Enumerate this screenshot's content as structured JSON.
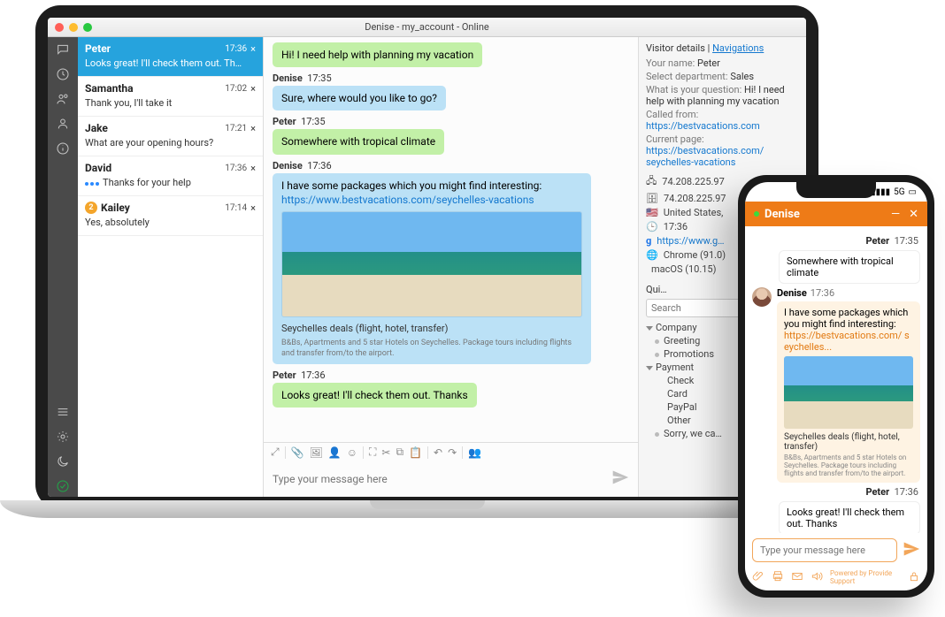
{
  "desktop": {
    "window_title": "Denise - my_account - Online",
    "conversations": [
      {
        "name": "Peter",
        "time": "17:36",
        "snippet": "Looks great! I'll check them out. Th…",
        "active": true,
        "close": "×"
      },
      {
        "name": "Samantha",
        "time": "17:02",
        "snippet": "Thank you, I'll take it",
        "close": "×"
      },
      {
        "name": "Jake",
        "time": "17:21",
        "snippet": "What are your opening hours?",
        "close": "×"
      },
      {
        "name": "David",
        "time": "17:36",
        "snippet": "Thanks for your help",
        "close": "×",
        "typing": true
      },
      {
        "name": "Kailey",
        "time": "17:14",
        "snippet": "Yes, absolutely",
        "close": "×",
        "badge": "2"
      }
    ],
    "messages": [
      {
        "author": "",
        "time": "",
        "type": "green",
        "text": "Hi! I need help with planning my vacation"
      },
      {
        "author": "Denise",
        "time": "17:35",
        "type": "blue",
        "text": "Sure, where would you like to go?"
      },
      {
        "author": "Peter",
        "time": "17:35",
        "type": "green",
        "text": "Somewhere with tropical climate"
      },
      {
        "author": "Denise",
        "time": "17:36",
        "type": "package",
        "lead": "I have some packages which you might find interesting:",
        "link": "https://www.bestvacations.com/seychelles-vacations",
        "caption1": "Seychelles deals (flight, hotel, transfer)",
        "caption2": "B&Bs, Apartments and 5 star Hotels on Seychelles. Package tours including flights and transfer from/to the airport."
      },
      {
        "author": "Peter",
        "time": "17:36",
        "type": "green",
        "text": "Looks great! I'll check them out. Thanks"
      }
    ],
    "compose_placeholder": "Type your message here",
    "details": {
      "tab_visitor": "Visitor details",
      "tab_nav": "Navigations",
      "your_name_label": "Your name:",
      "your_name": "Peter",
      "dept_label": "Select department:",
      "dept": "Sales",
      "q_label": "What is your question:",
      "q": "Hi! I need help with planning my vacation",
      "called_label": "Called from:",
      "called": "https://bestvacations.com",
      "page_label": "Current page:",
      "page": "https://bestvacations.com/ seychelles-vacations",
      "ip": "74.208.225.97",
      "ip2": "74.208.225.97",
      "country": "United States,",
      "time": "17:36",
      "google": "https://www.g…",
      "browser": "Chrome (91.0)",
      "os": "macOS (10.15)",
      "qui": "Qui…",
      "search_placeholder": "Search",
      "tree": [
        {
          "lvl": 0,
          "label": "Company",
          "exp": true
        },
        {
          "lvl": 1,
          "label": "Greeting"
        },
        {
          "lvl": 1,
          "label": "Promotions"
        },
        {
          "lvl": 0,
          "label": "Payment",
          "exp": true
        },
        {
          "lvl": 1,
          "label": "Check"
        },
        {
          "lvl": 1,
          "label": "Card"
        },
        {
          "lvl": 1,
          "label": "PayPal"
        },
        {
          "lvl": 1,
          "label": "Other"
        },
        {
          "lvl": 0,
          "label": "Sorry, we ca…"
        }
      ]
    }
  },
  "phone": {
    "status": {
      "signal": "5G"
    },
    "header": {
      "name": "Denise",
      "min": "—",
      "close": "✕"
    },
    "thread": [
      {
        "side": "right",
        "author": "Peter",
        "time": "17:35",
        "text": "Somewhere with tropical climate"
      },
      {
        "side": "left",
        "author": "Denise",
        "time": "17:36",
        "lead": "I have some packages which you might find interesting:",
        "link": "https://bestvacations.com/ seychelles...",
        "caption1": "Seychelles deals (flight, hotel, transfer)",
        "caption2": "B&Bs, Apartments and 5 star Hotels on Seychelles. Package tours including flights and transfer from/to the airport."
      },
      {
        "side": "right",
        "author": "Peter",
        "time": "17:36",
        "text": "Looks great! I'll check them out. Thanks"
      }
    ],
    "compose_placeholder": "Type your message here",
    "powered": "Powered by Provide Support"
  }
}
